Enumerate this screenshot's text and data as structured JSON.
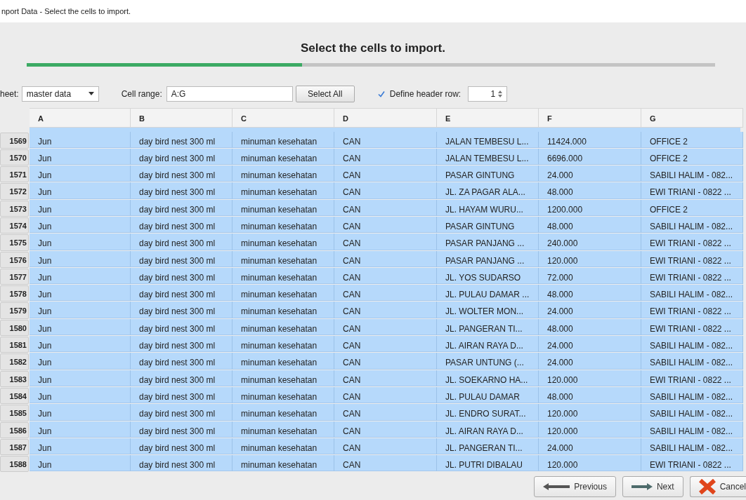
{
  "window": {
    "title": "nport Data - Select the cells to import."
  },
  "heading": "Select the cells to import.",
  "progress": {
    "level": 0.4
  },
  "sheet": {
    "label": "heet:",
    "value": "master data"
  },
  "cell_range": {
    "label": "Cell range:",
    "value": "A:G"
  },
  "select_all": "Select All",
  "header_row": {
    "label": "Define header row:",
    "checked": true,
    "value": "1"
  },
  "table": {
    "columns": [
      "A",
      "B",
      "C",
      "D",
      "E",
      "F",
      "G"
    ],
    "rows": [
      {
        "number": "1569",
        "selected": true,
        "cells": [
          "Jun",
          "day bird nest 300 ml",
          "minuman kesehatan",
          "CAN",
          "JALAN TEMBESU L...",
          "11424.000",
          "OFFICE 2"
        ]
      },
      {
        "number": "1570",
        "selected": true,
        "cells": [
          "Jun",
          "day bird nest 300 ml",
          "minuman kesehatan",
          "CAN",
          "JALAN TEMBESU L...",
          "6696.000",
          "OFFICE 2"
        ]
      },
      {
        "number": "1571",
        "selected": true,
        "cells": [
          "Jun",
          "day bird nest 300 ml",
          "minuman kesehatan",
          "CAN",
          "PASAR GINTUNG",
          "24.000",
          "SABILI HALIM - 082..."
        ]
      },
      {
        "number": "1572",
        "selected": true,
        "cells": [
          "Jun",
          "day bird nest 300 ml",
          "minuman kesehatan",
          "CAN",
          "JL. ZA PAGAR ALA...",
          "48.000",
          "EWI TRIANI - 0822 ..."
        ]
      },
      {
        "number": "1573",
        "selected": true,
        "cells": [
          "Jun",
          "day bird nest 300 ml",
          "minuman kesehatan",
          "CAN",
          "JL. HAYAM WURU...",
          "1200.000",
          "OFFICE 2"
        ]
      },
      {
        "number": "1574",
        "selected": true,
        "cells": [
          "Jun",
          "day bird nest 300 ml",
          "minuman kesehatan",
          "CAN",
          "PASAR GINTUNG",
          "48.000",
          "SABILI HALIM - 082..."
        ]
      },
      {
        "number": "1575",
        "selected": true,
        "cells": [
          "Jun",
          "day bird nest 300 ml",
          "minuman kesehatan",
          "CAN",
          "PASAR PANJANG ...",
          "240.000",
          "EWI TRIANI - 0822 ..."
        ]
      },
      {
        "number": "1576",
        "selected": true,
        "cells": [
          "Jun",
          "day bird nest 300 ml",
          "minuman kesehatan",
          "CAN",
          "PASAR PANJANG ...",
          "120.000",
          "EWI TRIANI - 0822 ..."
        ]
      },
      {
        "number": "1577",
        "selected": true,
        "cells": [
          "Jun",
          "day bird nest 300 ml",
          "minuman kesehatan",
          "CAN",
          "JL. YOS SUDARSO",
          "72.000",
          "EWI TRIANI - 0822 ..."
        ]
      },
      {
        "number": "1578",
        "selected": true,
        "cells": [
          "Jun",
          "day bird nest 300 ml",
          "minuman kesehatan",
          "CAN",
          "JL. PULAU DAMAR ...",
          "48.000",
          "SABILI HALIM - 082..."
        ]
      },
      {
        "number": "1579",
        "selected": true,
        "cells": [
          "Jun",
          "day bird nest 300 ml",
          "minuman kesehatan",
          "CAN",
          "JL. WOLTER MON...",
          "24.000",
          "EWI TRIANI - 0822 ..."
        ]
      },
      {
        "number": "1580",
        "selected": true,
        "cells": [
          "Jun",
          "day bird nest 300 ml",
          "minuman kesehatan",
          "CAN",
          "JL. PANGERAN TI...",
          "48.000",
          "EWI TRIANI - 0822 ..."
        ]
      },
      {
        "number": "1581",
        "selected": true,
        "cells": [
          "Jun",
          "day bird nest 300 ml",
          "minuman kesehatan",
          "CAN",
          "JL. AIRAN RAYA D...",
          "24.000",
          "SABILI HALIM - 082..."
        ]
      },
      {
        "number": "1582",
        "selected": true,
        "cells": [
          "Jun",
          "day bird nest 300 ml",
          "minuman kesehatan",
          "CAN",
          "PASAR UNTUNG (...",
          "24.000",
          "SABILI HALIM - 082..."
        ]
      },
      {
        "number": "1583",
        "selected": true,
        "cells": [
          "Jun",
          "day bird nest 300 ml",
          "minuman kesehatan",
          "CAN",
          "JL. SOEKARNO HA...",
          "120.000",
          "EWI TRIANI - 0822 ..."
        ]
      },
      {
        "number": "1584",
        "selected": true,
        "cells": [
          "Jun",
          "day bird nest 300 ml",
          "minuman kesehatan",
          "CAN",
          "JL. PULAU DAMAR",
          "48.000",
          "SABILI HALIM - 082..."
        ]
      },
      {
        "number": "1585",
        "selected": true,
        "cells": [
          "Jun",
          "day bird nest 300 ml",
          "minuman kesehatan",
          "CAN",
          "JL. ENDRO SURAT...",
          "120.000",
          "SABILI HALIM - 082..."
        ]
      },
      {
        "number": "1586",
        "selected": true,
        "cells": [
          "Jun",
          "day bird nest 300 ml",
          "minuman kesehatan",
          "CAN",
          "JL. AIRAN RAYA D...",
          "120.000",
          "SABILI HALIM - 082..."
        ]
      },
      {
        "number": "1587",
        "selected": true,
        "cells": [
          "Jun",
          "day bird nest 300 ml",
          "minuman kesehatan",
          "CAN",
          "JL. PANGERAN TI...",
          "24.000",
          "SABILI HALIM - 082..."
        ]
      },
      {
        "number": "1588",
        "selected": true,
        "cells": [
          "Jun",
          "day bird nest 300 ml",
          "minuman kesehatan",
          "CAN",
          "JL. PUTRI DIBALAU",
          "120.000",
          "EWI TRIANI - 0822 ..."
        ]
      }
    ]
  },
  "buttons": [
    {
      "kind": "previous",
      "label": "Previous"
    },
    {
      "kind": "next",
      "label": "Next"
    },
    {
      "kind": "cancel",
      "label": "Cancel"
    }
  ]
}
